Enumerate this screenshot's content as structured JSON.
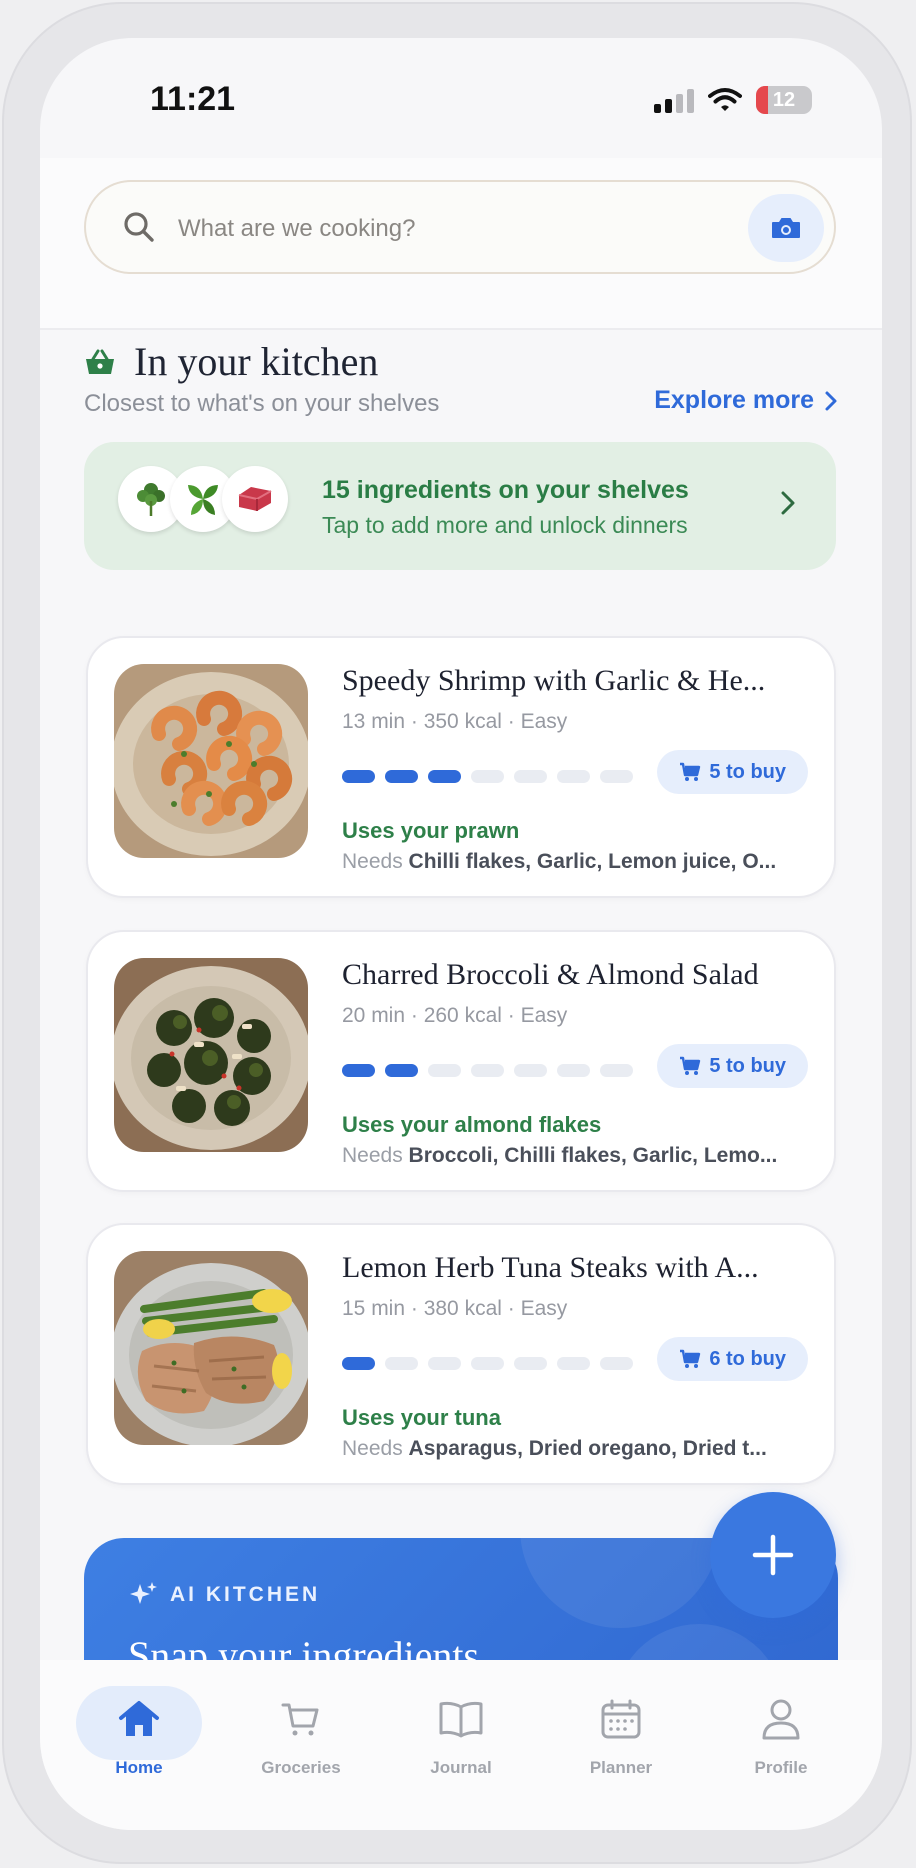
{
  "status_bar": {
    "time": "11:21",
    "battery": "12"
  },
  "search": {
    "placeholder": "What are we cooking?"
  },
  "kitchen": {
    "title": "In your kitchen",
    "subtitle": "Closest to what's on your shelves",
    "explore_label": "Explore more"
  },
  "shelves": {
    "title": "15 ingredients on your shelves",
    "subtitle": "Tap to add more and unlock dinners",
    "icons": [
      "herb-icon",
      "basil-icon",
      "meat-icon"
    ]
  },
  "recipes": [
    {
      "title": "Speedy Shrimp with Garlic & He...",
      "meta": "13 min · 350 kcal · Easy",
      "progress_filled": 3,
      "progress_total": 7,
      "buy": "5 to buy",
      "uses": "Uses your prawn",
      "needs_label": "Needs",
      "needs": "Chilli flakes, Garlic, Lemon juice, O..."
    },
    {
      "title": "Charred Broccoli & Almond Salad",
      "meta": "20 min · 260 kcal · Easy",
      "progress_filled": 2,
      "progress_total": 7,
      "buy": "5 to buy",
      "uses": "Uses your almond flakes",
      "needs_label": "Needs",
      "needs": "Broccoli, Chilli flakes, Garlic, Lemo..."
    },
    {
      "title": "Lemon Herb Tuna Steaks with A...",
      "meta": "15 min · 380 kcal · Easy",
      "progress_filled": 1,
      "progress_total": 7,
      "buy": "6 to buy",
      "uses": "Uses your tuna",
      "needs_label": "Needs",
      "needs": "Asparagus, Dried oregano, Dried t..."
    }
  ],
  "ai_kitchen": {
    "label": "AI KITCHEN",
    "title": "Snap your ingredients"
  },
  "tabs": [
    {
      "label": "Home",
      "icon": "home-icon",
      "active": true
    },
    {
      "label": "Groceries",
      "icon": "cart-icon",
      "active": false
    },
    {
      "label": "Journal",
      "icon": "book-icon",
      "active": false
    },
    {
      "label": "Planner",
      "icon": "calendar-icon",
      "active": false
    },
    {
      "label": "Profile",
      "icon": "user-icon",
      "active": false
    }
  ],
  "colors": {
    "accent": "#2f6ad9",
    "green": "#2e8049",
    "shelf_bg": "#e2efe4"
  }
}
